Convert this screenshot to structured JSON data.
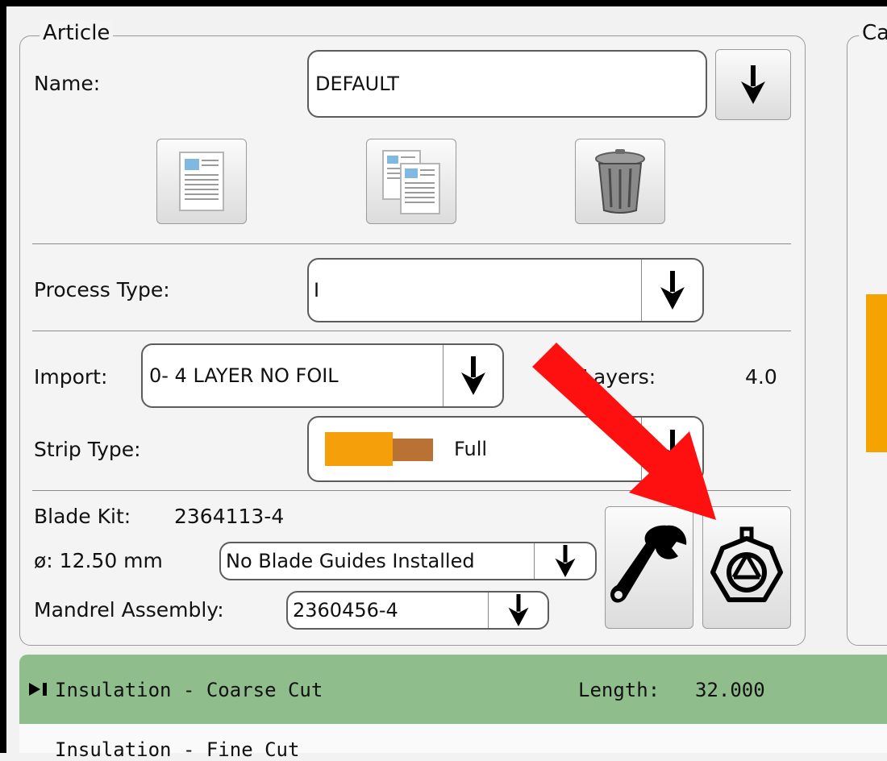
{
  "article": {
    "title": "Article",
    "name_label": "Name:",
    "name_value": "DEFAULT",
    "icons": [
      "new-document-icon",
      "copy-document-icon",
      "trash-can-icon",
      "dropdown-arrow-icon"
    ],
    "process_type_label": "Process Type:",
    "process_type_value": "I",
    "import_label": "Import:",
    "import_value": "0- 4 LAYER NO FOIL",
    "layers_label": "Layers:",
    "layers_value": "4.0",
    "strip_type_label": "Strip Type:",
    "strip_type_value": "Full",
    "blade_kit_label": "Blade Kit:",
    "blade_kit_value": "2364113-4",
    "diameter_label": "ø: 12.50 mm",
    "blade_guides_value": "No Blade Guides Installed",
    "mandrel_label": "Mandrel Assembly:",
    "mandrel_value": "2360456-4",
    "tool_icons": [
      "wrench-icon",
      "blade-head-icon"
    ]
  },
  "right_group": {
    "title_fragment": "Ca"
  },
  "steps": {
    "active_step": "Insulation - Coarse Cut",
    "length_label": "Length:",
    "length_value": "32.000",
    "next_step": "Insulation - Fine Cut"
  },
  "colors": {
    "strip_orange": "#f5a00a",
    "strip_brown": "#b97233",
    "accent_orange": "#f5a300",
    "step_green": "#8fbd8c",
    "annotation_red": "#ff1010"
  }
}
